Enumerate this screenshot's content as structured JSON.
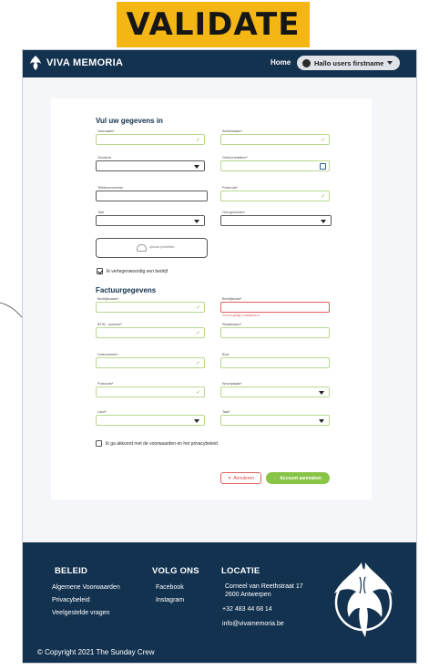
{
  "banner": {
    "label": "VALIDATE",
    "color": "#f3b614"
  },
  "header": {
    "brand": "VIVA MEMORIA",
    "nav_home": "Home",
    "user_greeting": "Hallo users firstname"
  },
  "form": {
    "section_personal": "Vul uw gegevens in",
    "fields_personal": {
      "voornaam": "Voornaam*",
      "achternaam": "Achternaam*",
      "geslacht": "Geslacht",
      "geboortedatum": "Geboortedatum*",
      "telefoon": "Telefoonnummer",
      "postcode": "Postcode*",
      "taal": "Taal",
      "ons_gevonden": "Ons gevonden"
    },
    "upload_text": "Upload profielfoto",
    "company_checkbox": "Ik vertegenwoordig een bedrijf",
    "section_billing": "Factuurgegevens",
    "fields_billing": {
      "bedrijfsnaam": "Bedrijfsnaam*",
      "bedrijfsmail": "Bedrijfsmail*",
      "bedrijfsmail_error": "Vul een geldig e-mailadres in",
      "btw": "BTW - nummer*",
      "straatnaam": "Straatnaam*",
      "huisnummer": "Huisnummer*",
      "bus": "Bus*",
      "postcode": "Postcode*",
      "woonplaats": "Woonplaats*",
      "land": "Land*",
      "taal": "Taal*"
    },
    "terms_checkbox": "Ik ga akkoord met de voorwaarden en het privacybeleid",
    "cancel_label": "Annuleren",
    "create_label": "Account aanmaken"
  },
  "footer": {
    "col1_title": "BELEID",
    "col1_links": [
      "Algemene Voorwaarden",
      "Privacybeleid",
      "Veelgestelde vragen"
    ],
    "col2_title": "VOLG ONS",
    "col2_links": [
      "Facebook",
      "Instagram"
    ],
    "col3_title": "LOCATIE",
    "address_line1": "Corneel van Reethstraat 17",
    "address_line2": "2600 Antwerpen",
    "phone": "+32 483 44 68 14",
    "email": "info@vivamemoria.be",
    "copyright": "© Copyright 2021 The Sunday Crew"
  },
  "colors": {
    "navy": "#13324f",
    "valid_green": "#8cbf48",
    "error_red": "#e06060",
    "button_green": "#88c445"
  }
}
